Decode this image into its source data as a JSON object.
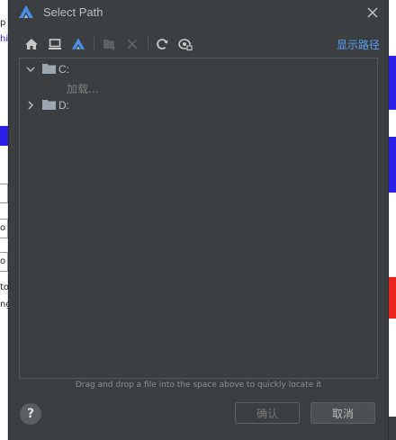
{
  "background": {
    "left_fragments": [
      "p",
      "hi",
      "o",
      "o",
      "to",
      "ng"
    ]
  },
  "dialog": {
    "title": "Select Path",
    "icons": {
      "app": "harmony-logo-icon",
      "close": "close-icon"
    }
  },
  "toolbar": {
    "items": [
      {
        "name": "home-icon"
      },
      {
        "name": "desktop-icon"
      },
      {
        "name": "project-icon"
      },
      {
        "name": "new-folder-icon",
        "disabled": true
      },
      {
        "name": "delete-icon",
        "disabled": true
      },
      {
        "name": "refresh-icon"
      },
      {
        "name": "hidden-files-icon"
      }
    ],
    "show_path_label": "显示路径"
  },
  "tree": {
    "nodes": [
      {
        "label": "C:",
        "expanded": true,
        "children_status": "加载..."
      },
      {
        "label": "D:",
        "expanded": false
      }
    ]
  },
  "hint": "Drag and drop a file into the space above to quickly locate it",
  "footer": {
    "help_label": "?",
    "ok_label": "确认",
    "cancel_label": "取消"
  },
  "colors": {
    "dialog_bg": "#3c3f41",
    "text": "#bbbbbb",
    "link": "#589df6",
    "accent_blue": "#2b20e8",
    "accent_red": "#e8241c"
  }
}
